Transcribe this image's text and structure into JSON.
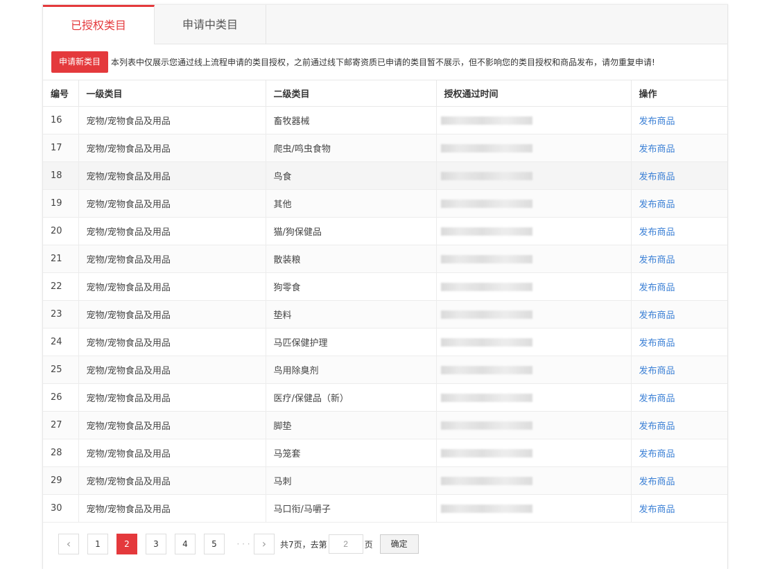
{
  "tabs": {
    "active": "已授权类目",
    "other": "申请中类目"
  },
  "notice": {
    "button": "申请新类目",
    "text": "本列表中仅展示您通过线上流程申请的类目授权，之前通过线下邮寄资质已申请的类目暂不展示，但不影响您的类目授权和商品发布，请勿重复申请!"
  },
  "table": {
    "headers": {
      "num": "编号",
      "level1": "一级类目",
      "level2": "二级类目",
      "time": "授权通过时间",
      "op": "操作"
    },
    "rows": [
      {
        "num": "16",
        "level1": "宠物/宠物食品及用品",
        "level2": "畜牧器械",
        "op": "发布商品"
      },
      {
        "num": "17",
        "level1": "宠物/宠物食品及用品",
        "level2": "爬虫/鸣虫食物",
        "op": "发布商品"
      },
      {
        "num": "18",
        "level1": "宠物/宠物食品及用品",
        "level2": "鸟食",
        "op": "发布商品"
      },
      {
        "num": "19",
        "level1": "宠物/宠物食品及用品",
        "level2": "其他",
        "op": "发布商品"
      },
      {
        "num": "20",
        "level1": "宠物/宠物食品及用品",
        "level2": "猫/狗保健品",
        "op": "发布商品"
      },
      {
        "num": "21",
        "level1": "宠物/宠物食品及用品",
        "level2": "散装粮",
        "op": "发布商品"
      },
      {
        "num": "22",
        "level1": "宠物/宠物食品及用品",
        "level2": "狗零食",
        "op": "发布商品"
      },
      {
        "num": "23",
        "level1": "宠物/宠物食品及用品",
        "level2": "垫料",
        "op": "发布商品"
      },
      {
        "num": "24",
        "level1": "宠物/宠物食品及用品",
        "level2": "马匹保健护理",
        "op": "发布商品"
      },
      {
        "num": "25",
        "level1": "宠物/宠物食品及用品",
        "level2": "鸟用除臭剂",
        "op": "发布商品"
      },
      {
        "num": "26",
        "level1": "宠物/宠物食品及用品",
        "level2": "医疗/保健品（新）",
        "op": "发布商品"
      },
      {
        "num": "27",
        "level1": "宠物/宠物食品及用品",
        "level2": "脚垫",
        "op": "发布商品"
      },
      {
        "num": "28",
        "level1": "宠物/宠物食品及用品",
        "level2": "马笼套",
        "op": "发布商品"
      },
      {
        "num": "29",
        "level1": "宠物/宠物食品及用品",
        "level2": "马刺",
        "op": "发布商品"
      },
      {
        "num": "30",
        "level1": "宠物/宠物食品及用品",
        "level2": "马口衔/马嚼子",
        "op": "发布商品"
      }
    ]
  },
  "pager": {
    "pages": [
      "1",
      "2",
      "3",
      "4",
      "5"
    ],
    "current": "2",
    "ellipsis": "· · ·",
    "total_prefix": "共7页，去第",
    "input_value": "2",
    "suffix": "页",
    "confirm": "确定"
  }
}
